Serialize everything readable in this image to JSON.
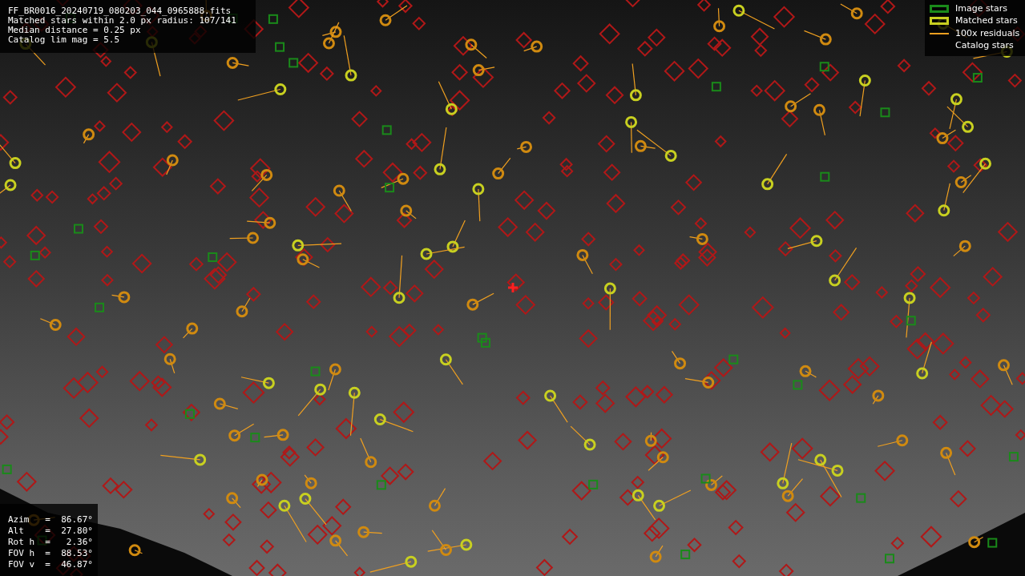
{
  "info": {
    "lines": [
      "FF_BR0016_20240719_080203_044_0965888.fits",
      "Matched stars within 2.0 px radius: 107/141",
      "Median distance = 0.25 px",
      "Catalog lim mag = 5.5"
    ]
  },
  "legend": [
    {
      "kind": "image",
      "label": "Image stars"
    },
    {
      "kind": "matched",
      "label": "Matched stars"
    },
    {
      "kind": "residual",
      "label": "100x residuals"
    },
    {
      "kind": "catalog",
      "label": "Catalog stars"
    }
  ],
  "pointing": [
    "Azim   =  86.67°",
    "Alt    =  27.80°",
    "Rot h  =   2.36°",
    "FOV h  =  88.53°",
    "FOV v  =  46.87°"
  ]
}
